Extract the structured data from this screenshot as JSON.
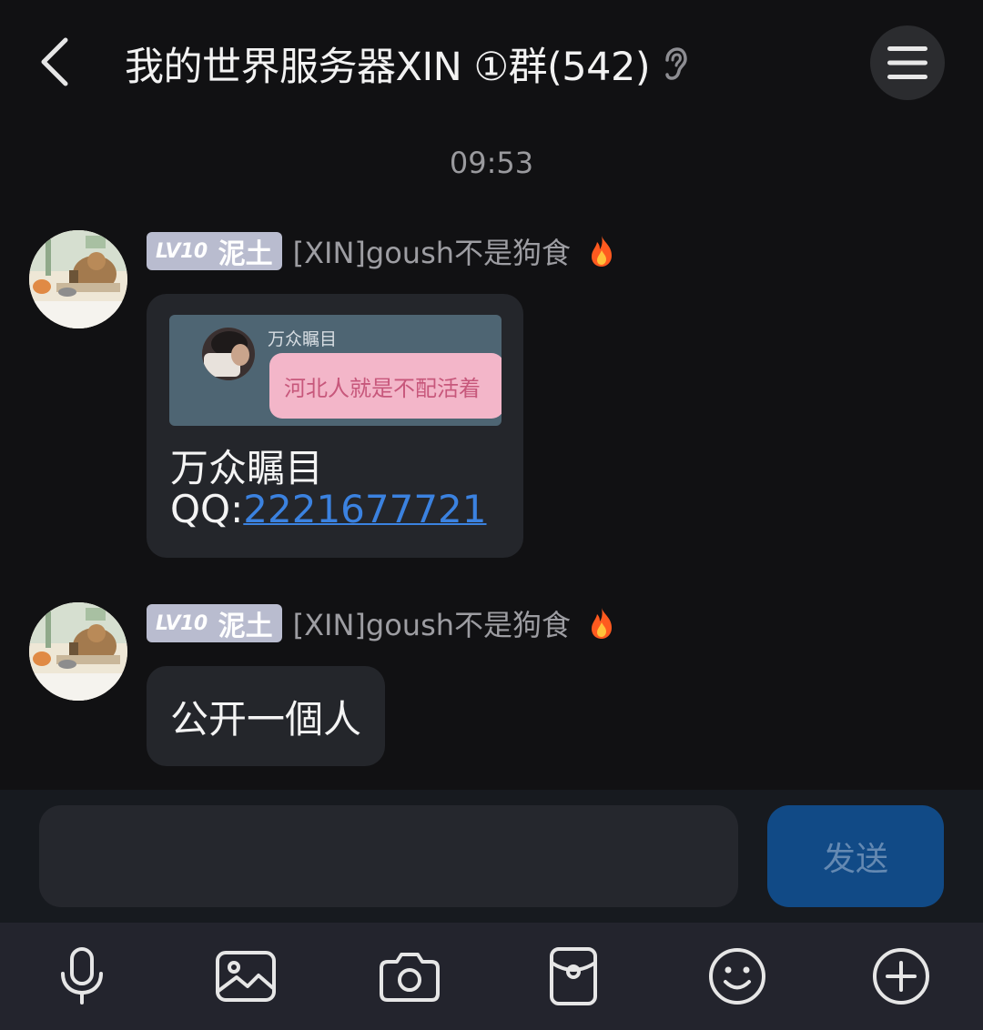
{
  "header": {
    "title": "我的世界服务器XIN ①群(542)",
    "back_icon": "chevron-left-icon",
    "ear_icon": "ear-icon",
    "menu_icon": "hamburger-menu-icon"
  },
  "timestamp": "09:53",
  "messages": [
    {
      "level": "LV10",
      "title_badge": "泥土",
      "sender": "[XIN]goush不是狗食",
      "badge_icon": "fire-icon",
      "card": {
        "image_name": "万众瞩目",
        "image_quote": "河北人就是不配活着",
        "title": "万众瞩目",
        "qq_prefix": "QQ:",
        "qq_number": "2221677721"
      }
    },
    {
      "level": "LV10",
      "title_badge": "泥土",
      "sender": "[XIN]goush不是狗食",
      "badge_icon": "fire-icon",
      "text": "公开一個人"
    }
  ],
  "input": {
    "value": "",
    "placeholder": "",
    "send_label": "发送"
  },
  "toolbar": {
    "icons": [
      "microphone-icon",
      "image-icon",
      "camera-icon",
      "red-packet-icon",
      "emoji-icon",
      "plus-icon"
    ]
  },
  "colors": {
    "background": "#111113",
    "bubble": "#24262b",
    "send_button": "#114a86",
    "link": "#3b82e0",
    "level_badge": "#b9bccf"
  }
}
